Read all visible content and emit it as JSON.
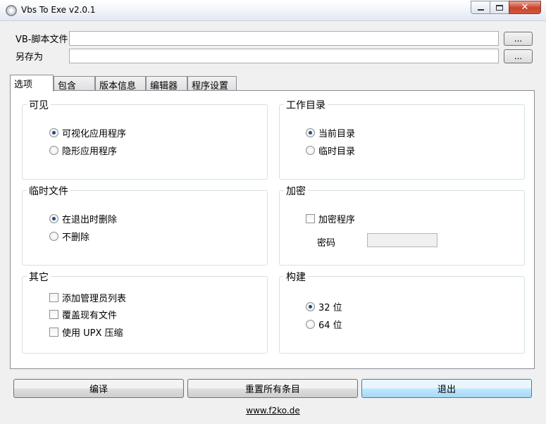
{
  "window": {
    "title": "Vbs To Exe v2.0.1",
    "controls": {
      "minimize": "",
      "maximize": "",
      "close": "✕"
    }
  },
  "files": {
    "script_label": "VB-脚本文件",
    "script_value": "",
    "save_label": "另存为",
    "save_value": "",
    "browse_label": "..."
  },
  "tabs": [
    {
      "label": "选项",
      "active": true
    },
    {
      "label": "包含",
      "active": false
    },
    {
      "label": "版本信息",
      "active": false
    },
    {
      "label": "编辑器",
      "active": false
    },
    {
      "label": "程序设置",
      "active": false
    }
  ],
  "options": {
    "visibility": {
      "title": "可见",
      "items": [
        {
          "label": "可视化应用程序",
          "checked": true
        },
        {
          "label": "隐形应用程序",
          "checked": false
        }
      ]
    },
    "working_dir": {
      "title": "工作目录",
      "items": [
        {
          "label": "当前目录",
          "checked": true
        },
        {
          "label": "临时目录",
          "checked": false
        }
      ]
    },
    "temp_files": {
      "title": "临时文件",
      "items": [
        {
          "label": "在退出时删除",
          "checked": true
        },
        {
          "label": "不删除",
          "checked": false
        }
      ]
    },
    "encryption": {
      "title": "加密",
      "encrypt_label": "加密程序",
      "encrypt_checked": false,
      "password_label": "密码",
      "password_value": ""
    },
    "other": {
      "title": "其它",
      "items": [
        {
          "label": "添加管理员列表",
          "checked": false
        },
        {
          "label": "覆盖现有文件",
          "checked": false
        },
        {
          "label": "使用 UPX 压缩",
          "checked": false
        }
      ]
    },
    "build": {
      "title": "构建",
      "items": [
        {
          "label": "32 位",
          "checked": true
        },
        {
          "label": "64 位",
          "checked": false
        }
      ]
    }
  },
  "actions": {
    "compile": "编译",
    "reset": "重置所有条目",
    "exit": "退出"
  },
  "footer": {
    "link": "www.f2ko.de"
  }
}
